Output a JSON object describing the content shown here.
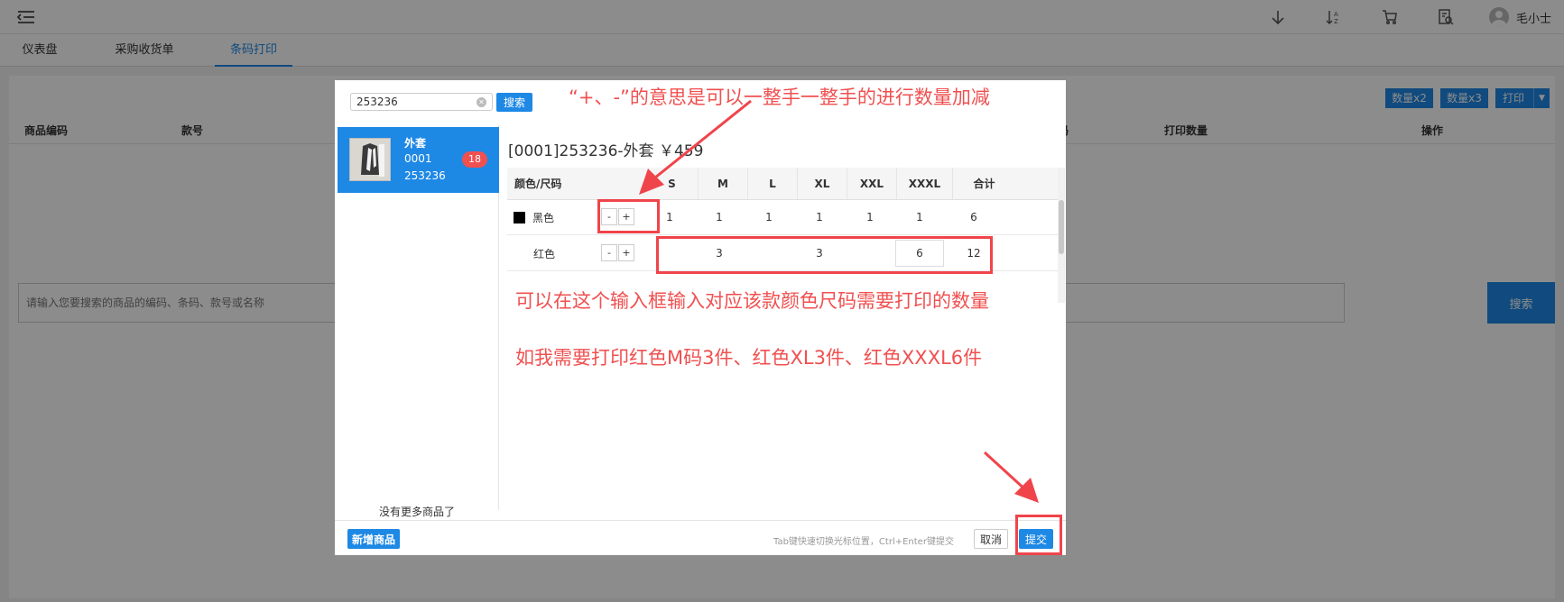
{
  "topbar": {
    "icons": [
      "arrow-down-icon",
      "sort-az-icon",
      "cart-icon",
      "receipt-search-icon"
    ],
    "user_name": "毛小士"
  },
  "tabs": [
    {
      "label": "仪表盘",
      "active": false
    },
    {
      "label": "采购收货单",
      "active": false
    },
    {
      "label": "条码打印",
      "active": true
    }
  ],
  "actions": {
    "qty_x2": "数量x2",
    "qty_x3": "数量x3",
    "print": "打印"
  },
  "table_headers": {
    "col1": "商品编码",
    "col2": "款号",
    "col3": "码",
    "col4": "打印数量",
    "col5": "操作"
  },
  "bg_search": {
    "placeholder": "请输入您要搜索的商品的编码、条码、款号或名称",
    "button": "搜索"
  },
  "modal": {
    "search_value": "253236",
    "search_button": "搜索",
    "product": {
      "name": "外套",
      "code": "0001",
      "style": "253236",
      "count_badge": "18"
    },
    "no_more": "没有更多商品了",
    "detail_title": "[0001]253236-外套 ￥459",
    "grid": {
      "color_size_header": "颜色/尺码",
      "sizes": [
        "S",
        "M",
        "L",
        "XL",
        "XXL",
        "XXXL"
      ],
      "total_header": "合计",
      "rows": [
        {
          "color": "黑色",
          "swatch": "#000000",
          "qty": [
            "1",
            "1",
            "1",
            "1",
            "1",
            "1"
          ],
          "total": "6"
        },
        {
          "color": "红色",
          "swatch": "",
          "qty": [
            "",
            "3",
            "",
            "3",
            "",
            "6"
          ],
          "total": "12"
        }
      ],
      "stepper_minus": "-",
      "stepper_plus": "+"
    },
    "footer": {
      "new_product": "新增商品",
      "hint": "Tab键快速切换光标位置，Ctrl+Enter键提交",
      "cancel": "取消",
      "submit": "提交"
    }
  },
  "annotations": {
    "note_stepper": "“+、-”的意思是可以一整手一整手的进行数量加减",
    "note_input": "可以在这个输入框输入对应该款颜色尺码需要打印的数量",
    "note_example": "如我需要打印红色M码3件、红色XL3件、红色XXXL6件",
    "color": "#f0444b"
  }
}
